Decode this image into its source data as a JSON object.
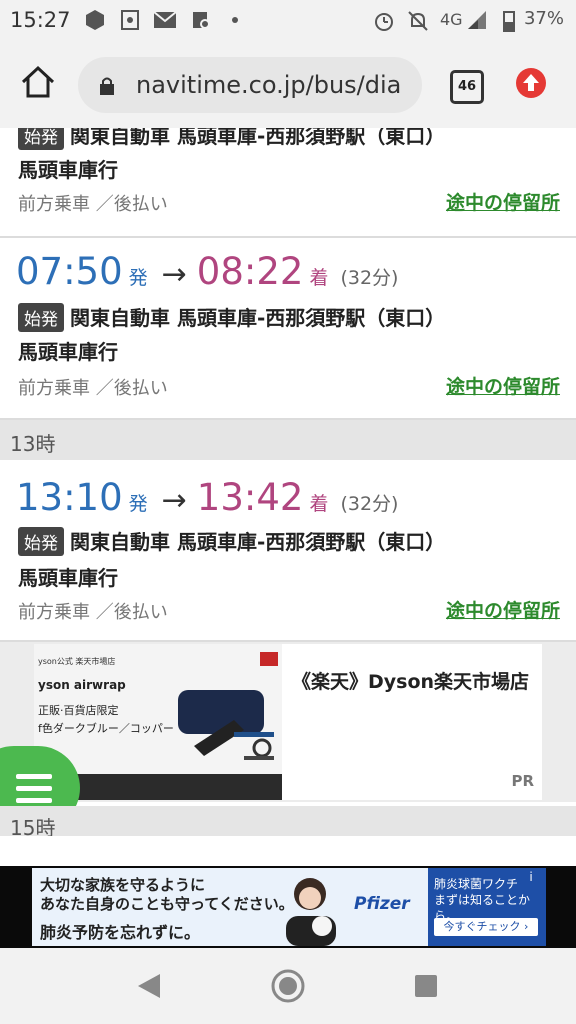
{
  "status_bar": {
    "time": "15:27",
    "network": "4G",
    "battery": "37%"
  },
  "browser": {
    "url": "navitime.co.jp/bus/dia",
    "tab_count": "46"
  },
  "partial_top": {
    "route": "関東自動車 馬頭車庫-西那須野駅（東口）",
    "badge": "始発",
    "destination": "馬頭車庫行",
    "boarding": "前方乗車 ／後払い",
    "stops_link": "途中の停留所"
  },
  "sections": [
    {
      "departure": "07:50",
      "dep_label": "発",
      "arrival": "08:22",
      "arr_label": "着",
      "duration": "(32分)",
      "badge": "始発",
      "route": "関東自動車 馬頭車庫-西那須野駅（東口）",
      "destination": "馬頭車庫行",
      "boarding": "前方乗車 ／後払い",
      "stops_link": "途中の停留所"
    },
    {
      "departure": "13:10",
      "dep_label": "発",
      "arrival": "13:42",
      "arr_label": "着",
      "duration": "(32分)",
      "badge": "始発",
      "route": "関東自動車 馬頭車庫-西那須野駅（東口）",
      "destination": "馬頭車庫行",
      "boarding": "前方乗車 ／後払い",
      "stops_link": "途中の停留所"
    }
  ],
  "hours": {
    "h13": "13時",
    "h15": "15時"
  },
  "ad": {
    "img_shop": "yson公式 楽天市場店",
    "img_brand": "yson airwrap",
    "img_line1": "正販·百貨店限定",
    "img_line2": "f色ダークブルー／コッパー",
    "title": "《楽天》Dyson楽天市場店",
    "pr": "PR"
  },
  "banner": {
    "line1": "大切な家族を守るように",
    "line2": "あなた自身のことも守ってください。",
    "line3": "肺炎予防を忘れずに。",
    "brand": "Pfizer",
    "right1": "肺炎球菌ワクチ",
    "right2": "まずは知ることから。",
    "button": "今すぐチェック ›"
  },
  "colors": {
    "departure": "#2d6fb7",
    "arrival": "#b0457f",
    "link": "#2d8a2d",
    "menu": "#4cb94f"
  }
}
